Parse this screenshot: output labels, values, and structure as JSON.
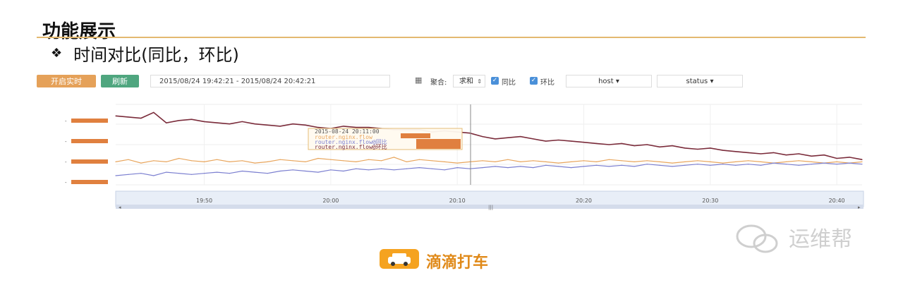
{
  "slide": {
    "title": "功能展示",
    "subtitle": "时间对比(同比，环比)",
    "bullet_icon": "diamond-bullet-icon"
  },
  "toolbar": {
    "realtime_label": "开启实时",
    "refresh_label": "刷新",
    "date_range": "2015/08/24 19:42:21 - 2015/08/24 20:42:21",
    "aggregate_label": "聚合:",
    "aggregate_value": "求和",
    "yoy_label": "同比",
    "yoy_checked": true,
    "mom_label": "环比",
    "mom_checked": true,
    "host_label": "host",
    "status_label": "status"
  },
  "tooltip": {
    "time": "2015-08-24 20:11:00",
    "line1": "router.nginx.flow",
    "line2": "router.nginx.flow@同比",
    "line3": "router.nginx.flow@环比"
  },
  "footer": {
    "brand": "滴滴打车",
    "watermark": "运维帮"
  },
  "colors": {
    "current": "#7a2b3a",
    "yoy": "#e8a55c",
    "mom": "#7b7fd0",
    "orange_btn": "#e5a159",
    "green_btn": "#4fa67f",
    "redaction": "#e0803f"
  },
  "chart_data": {
    "type": "line",
    "x": [
      "19:43",
      "19:44",
      "19:45",
      "19:46",
      "19:47",
      "19:48",
      "19:49",
      "19:50",
      "19:51",
      "19:52",
      "19:53",
      "19:54",
      "19:55",
      "19:56",
      "19:57",
      "19:58",
      "19:59",
      "20:00",
      "20:01",
      "20:02",
      "20:03",
      "20:04",
      "20:05",
      "20:06",
      "20:07",
      "20:08",
      "20:09",
      "20:10",
      "20:11",
      "20:12",
      "20:13",
      "20:14",
      "20:15",
      "20:16",
      "20:17",
      "20:18",
      "20:19",
      "20:20",
      "20:21",
      "20:22",
      "20:23",
      "20:24",
      "20:25",
      "20:26",
      "20:27",
      "20:28",
      "20:29",
      "20:30",
      "20:31",
      "20:32",
      "20:33",
      "20:34",
      "20:35",
      "20:36",
      "20:37",
      "20:38",
      "20:39",
      "20:40",
      "20:41",
      "20:42"
    ],
    "xticks": [
      "19:50",
      "20:00",
      "20:10",
      "20:20",
      "20:30",
      "20:40"
    ],
    "ylabel": "",
    "series": [
      {
        "name": "router.nginx.flow",
        "values": [
          90,
          89,
          88,
          93,
          84,
          86,
          87,
          85,
          84,
          83,
          85,
          83,
          82,
          81,
          83,
          82,
          80,
          79,
          81,
          80,
          80,
          79,
          78,
          78,
          78,
          76,
          77,
          76,
          75,
          72,
          70,
          71,
          72,
          70,
          68,
          69,
          68,
          67,
          66,
          65,
          66,
          64,
          65,
          63,
          64,
          62,
          61,
          62,
          60,
          59,
          58,
          57,
          58,
          56,
          57,
          55,
          56,
          53,
          54,
          52
        ]
      },
      {
        "name": "router.nginx.flow@同比",
        "values": [
          50,
          52,
          49,
          51,
          50,
          53,
          51,
          50,
          52,
          50,
          51,
          49,
          50,
          52,
          51,
          50,
          53,
          52,
          51,
          50,
          52,
          51,
          54,
          50,
          52,
          51,
          50,
          49,
          50,
          51,
          50,
          52,
          50,
          51,
          50,
          49,
          50,
          51,
          50,
          52,
          51,
          50,
          51,
          50,
          49,
          50,
          51,
          50,
          49,
          50,
          51,
          50,
          49,
          50,
          51,
          50,
          49,
          50,
          49,
          50
        ]
      },
      {
        "name": "router.nginx.flow@环比",
        "values": [
          38,
          39,
          40,
          38,
          41,
          40,
          39,
          40,
          41,
          40,
          42,
          41,
          40,
          42,
          43,
          42,
          41,
          43,
          42,
          44,
          43,
          44,
          43,
          44,
          45,
          44,
          43,
          45,
          44,
          45,
          46,
          45,
          46,
          45,
          47,
          46,
          45,
          46,
          47,
          46,
          47,
          46,
          48,
          47,
          46,
          47,
          48,
          47,
          48,
          47,
          48,
          47,
          49,
          48,
          47,
          48,
          49,
          48,
          49,
          48
        ]
      }
    ]
  }
}
